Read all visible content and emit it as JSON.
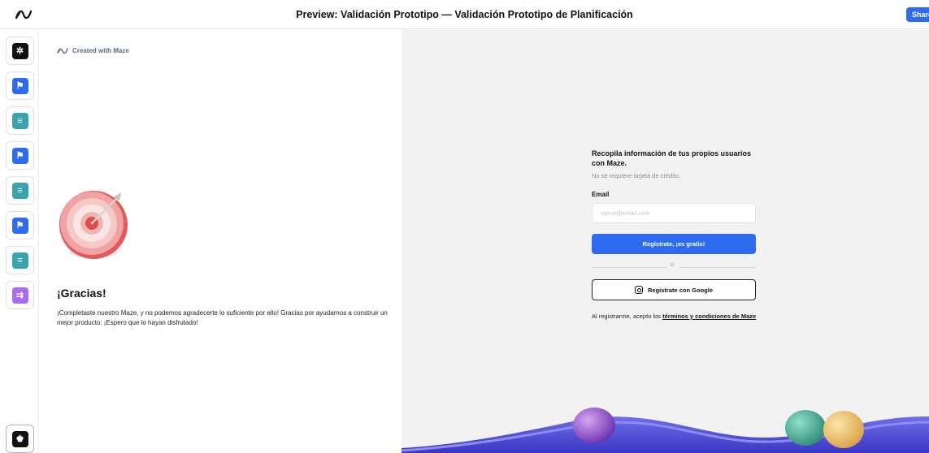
{
  "topbar": {
    "title": "Preview: Validación Prototipo — Validación Prototipo de Planificación",
    "share_label": "Share",
    "logo_icon": "maze-logo-icon"
  },
  "rail": {
    "items": [
      {
        "icon": "sparkle-icon",
        "color": "#111111",
        "glyph": "✲"
      },
      {
        "icon": "flag-icon",
        "color": "#2f6bef",
        "glyph": "⚑"
      },
      {
        "icon": "list-icon",
        "color": "#3aa3b0",
        "glyph": "≡"
      },
      {
        "icon": "flag-icon",
        "color": "#2f6bef",
        "glyph": "⚑"
      },
      {
        "icon": "list-icon",
        "color": "#3aa3b0",
        "glyph": "≡"
      },
      {
        "icon": "flag-icon",
        "color": "#2f6bef",
        "glyph": "⚑"
      },
      {
        "icon": "list-icon",
        "color": "#3aa3b0",
        "glyph": "≡"
      },
      {
        "icon": "text-arrow-icon",
        "color": "#a86cf0",
        "glyph": "⇉"
      }
    ],
    "bottom_item": {
      "icon": "trophy-icon",
      "glyph": "♚"
    }
  },
  "left": {
    "created_with": "Created with Maze",
    "thanks_title": "¡Gracias!",
    "thanks_body": "¡Completaste nuestro Maze, y no podemos agradecerte lo suficiente por ello! Gracias por ayudarnos a construir un mejor producto: ¡Espero que lo hayan disfrutado!"
  },
  "signup": {
    "title": "Recopila información de tus propios usuarios con Maze.",
    "subtitle": "No se requiere tarjeta de crédito.",
    "email_label": "Email",
    "email_placeholder": "name@email.com",
    "register_label": "Regístrate, ¡es gratis!",
    "divider_text": "o",
    "google_label": "Regístrate con Google",
    "terms_prefix": "Al registrarme, acepto los ",
    "terms_link": "términos y condiciones de Maze"
  },
  "colors": {
    "accent": "#2f6bef",
    "teal": "#3aa3b0",
    "purple": "#a86cf0"
  }
}
